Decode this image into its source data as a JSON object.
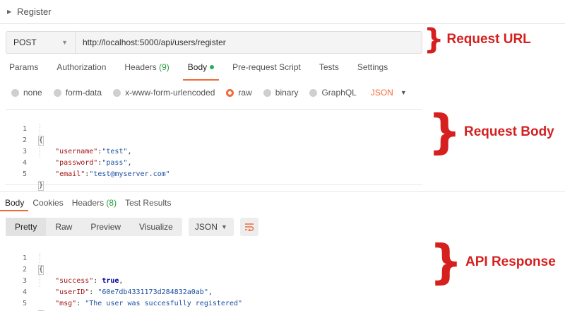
{
  "header": {
    "title": "Register"
  },
  "request": {
    "method": "POST",
    "url": "http://localhost:5000/api/users/register",
    "tabs": [
      {
        "label": "Params"
      },
      {
        "label": "Authorization"
      },
      {
        "label": "Headers",
        "count": "(9)"
      },
      {
        "label": "Body",
        "active": true
      },
      {
        "label": "Pre-request Script"
      },
      {
        "label": "Tests"
      },
      {
        "label": "Settings"
      }
    ],
    "body_types": [
      "none",
      "form-data",
      "x-www-form-urlencoded",
      "raw",
      "binary",
      "GraphQL"
    ],
    "body_type_selected": "raw",
    "body_format": "JSON",
    "body_lines": [
      {
        "n": "1",
        "text": "{"
      },
      {
        "n": "2",
        "key": "\"username\"",
        "sep": ":",
        "val": "\"test\"",
        "end": ","
      },
      {
        "n": "3",
        "key": "\"password\"",
        "sep": ":",
        "val": "\"pass\"",
        "end": ","
      },
      {
        "n": "4",
        "key": "\"email\"",
        "sep": ":",
        "val": "\"test@myserver.com\"",
        "end": ""
      },
      {
        "n": "5",
        "text": "}"
      }
    ]
  },
  "response": {
    "tabs": [
      {
        "label": "Body",
        "active": true
      },
      {
        "label": "Cookies"
      },
      {
        "label": "Headers",
        "count": "(8)"
      },
      {
        "label": "Test Results"
      }
    ],
    "views": [
      "Pretty",
      "Raw",
      "Preview",
      "Visualize"
    ],
    "view_selected": "Pretty",
    "format": "JSON",
    "lines": [
      {
        "n": "1",
        "text": "{"
      },
      {
        "n": "2",
        "key": "\"success\"",
        "sep": ": ",
        "val": "true",
        "end": ",",
        "kw": true
      },
      {
        "n": "3",
        "key": "\"userID\"",
        "sep": ": ",
        "val": "\"60e7db4331173d284832a0ab\"",
        "end": ","
      },
      {
        "n": "4",
        "key": "\"msg\"",
        "sep": ": ",
        "val": "\"The user was succesfully registered\"",
        "end": ""
      },
      {
        "n": "5",
        "text": "}"
      }
    ]
  },
  "annotations": {
    "request_url": "Request URL",
    "request_body": "Request Body",
    "api_response": "API Response"
  },
  "colors": {
    "accent": "#f26b3a",
    "annotation": "#d61f1f"
  }
}
